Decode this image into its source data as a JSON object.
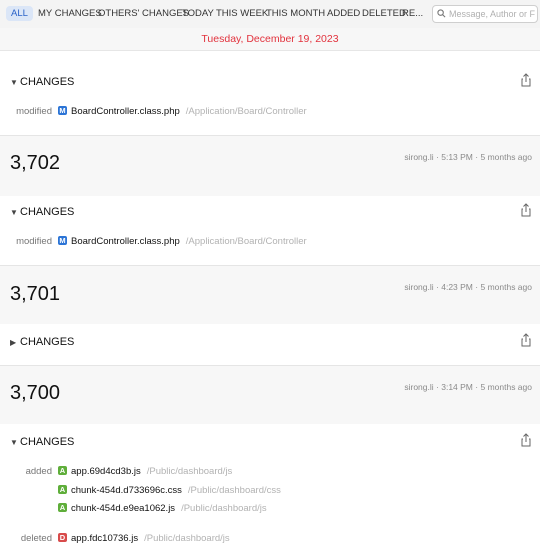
{
  "filters": {
    "all": "ALL",
    "mine": "MY CHANGES",
    "others": "OTHERS' CHANGES",
    "today": "TODAY",
    "week": "THIS WEEK",
    "month": "THIS MONTH",
    "added": "ADDED",
    "deleted": "DELETED",
    "re": "RE..."
  },
  "search": {
    "placeholder": "Message, Author or Fil"
  },
  "date_header": "Tuesday, December 19, 2023",
  "commits": [
    {
      "changes_label": "CHANGES",
      "groups": [
        {
          "action": "modified",
          "files": [
            {
              "status": "M",
              "name": "BoardController.class.php",
              "path": "/Application/Board/Controller"
            }
          ]
        }
      ]
    },
    {
      "number": "3,702",
      "author": "sirong.li",
      "time": "5:13 PM",
      "ago": "5 months ago",
      "changes_label": "CHANGES",
      "groups": [
        {
          "action": "modified",
          "files": [
            {
              "status": "M",
              "name": "BoardController.class.php",
              "path": "/Application/Board/Controller"
            }
          ]
        }
      ]
    },
    {
      "number": "3,701",
      "author": "sirong.li",
      "time": "4:23 PM",
      "ago": "5 months ago",
      "changes_label": "CHANGES"
    },
    {
      "number": "3,700",
      "author": "sirong.li",
      "time": "3:14 PM",
      "ago": "5 months ago",
      "changes_label": "CHANGES",
      "groups": [
        {
          "action": "added",
          "files": [
            {
              "status": "A",
              "name": "app.69d4cd3b.js",
              "path": "/Public/dashboard/js"
            },
            {
              "status": "A",
              "name": "chunk-454d.d733696c.css",
              "path": "/Public/dashboard/css"
            },
            {
              "status": "A",
              "name": "chunk-454d.e9ea1062.js",
              "path": "/Public/dashboard/js"
            }
          ]
        },
        {
          "action": "deleted",
          "files": [
            {
              "status": "D",
              "name": "app.fdc10736.js",
              "path": "/Public/dashboard/js"
            }
          ]
        }
      ]
    }
  ],
  "separator": "·"
}
